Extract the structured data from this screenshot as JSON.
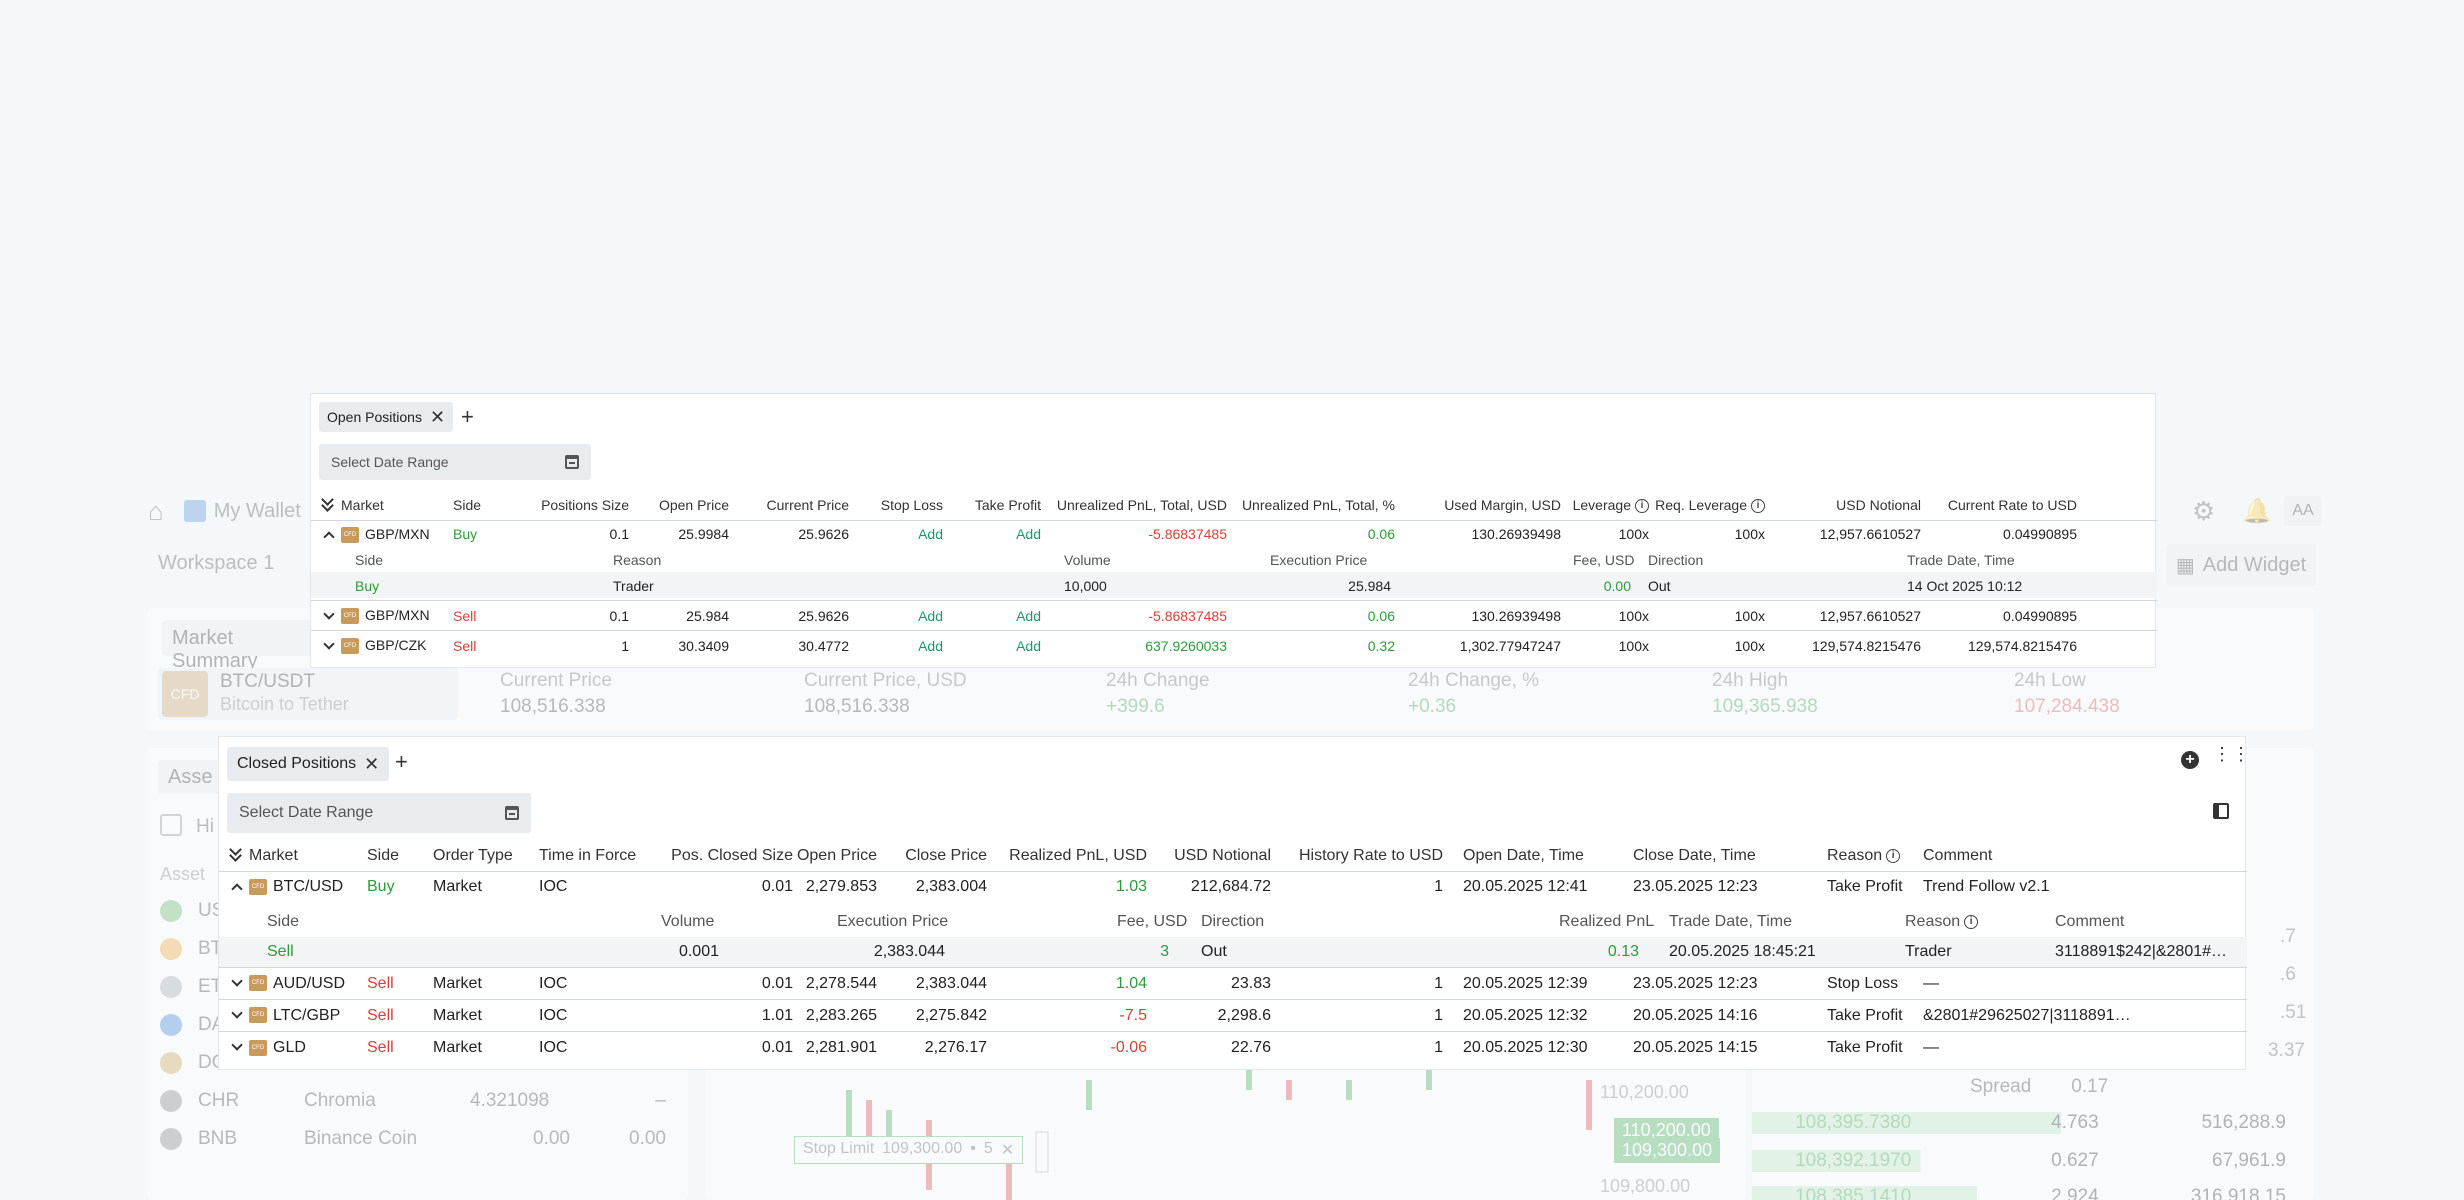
{
  "background": {
    "nav": {
      "wallet": "My Wallet",
      "avatar": "AA"
    },
    "workspace_title": "Workspace 1",
    "add_widget": "Add Widget",
    "market_summary": {
      "tab": "Market Summary",
      "symbol": "BTC/USDT",
      "symbol_sub": "Bitcoin to Tether",
      "cfd": "CFD",
      "stats": [
        {
          "label": "Current Price",
          "value": "108,516.338"
        },
        {
          "label": "Current Price, USD",
          "value": "108,516.338"
        },
        {
          "label": "24h Change",
          "value": "+399.6"
        },
        {
          "label": "24h Change, %",
          "value": "+0.36"
        },
        {
          "label": "24h High",
          "value": "109,365.938"
        },
        {
          "label": "24h Low",
          "value": "107,284.438"
        }
      ]
    },
    "assets": {
      "tab": "Asse",
      "hide_label": "Hi",
      "col_asset": "Asset",
      "rows": [
        {
          "code": "USD",
          "name": "",
          "a": "",
          "b": ""
        },
        {
          "code": "BTC",
          "name": "",
          "a": "",
          "b": ""
        },
        {
          "code": "ETH",
          "name": "",
          "a": "",
          "b": ""
        },
        {
          "code": "DAS",
          "name": "",
          "a": "",
          "b": ""
        },
        {
          "code": "DOG",
          "name": "",
          "a": "",
          "b": ""
        },
        {
          "code": "CHR",
          "name": "Chromia",
          "a": "4.321098",
          "b": "–"
        },
        {
          "code": "BNB",
          "name": "Binance Coin",
          "a": "0.00",
          "b": "0.00"
        }
      ]
    },
    "chart": {
      "prices": [
        "110,200.00",
        "110,200.00",
        "109,300.00",
        "109,800.00"
      ],
      "stop_limit": "Stop Limit",
      "stop_limit_price": "109,300.00",
      "stop_limit_qty": "5"
    },
    "book": {
      "spread_label": "Spread",
      "spread_value": "0.17",
      "side_values": [
        ".7",
        ".6",
        ".51",
        "3.37"
      ],
      "rows": [
        {
          "price": "108,395.7380",
          "qty": "4.763",
          "total": "516,288.9"
        },
        {
          "price": "108,392.1970",
          "qty": "0.627",
          "total": "67,961.9"
        },
        {
          "price": "108,385.1410",
          "qty": "2.924",
          "total": "316,918.15"
        }
      ]
    }
  },
  "open_positions": {
    "tab_label": "Open Positions",
    "date_range_placeholder": "Select Date Range",
    "columns": [
      "Market",
      "Side",
      "Positions Size",
      "Open Price",
      "Current Price",
      "Stop Loss",
      "Take Profit",
      "Unrealized PnL, Total, USD",
      "Unrealized PnL, Total, %",
      "Used Margin, USD",
      "Leverage",
      "Req. Leverage",
      "USD Notional",
      "Current Rate to USD"
    ],
    "sub_columns": [
      "Side",
      "Reason",
      "Volume",
      "Execution Price",
      "Fee, USD",
      "Direction",
      "Trade Date, Time"
    ],
    "rows": [
      {
        "market": "GBP/MXN",
        "side": "Buy",
        "size": "0.1",
        "open_price": "25.9984",
        "current_price": "25.9626",
        "stop_loss": "Add",
        "take_profit": "Add",
        "pnl_usd": "-5.86837485",
        "pnl_pct": "0.06",
        "margin": "130.26939498",
        "leverage": "100x",
        "req_leverage": "100x",
        "notional": "12,957.6610527",
        "rate": "0.04990895",
        "expanded": true
      },
      {
        "market": "GBP/MXN",
        "side": "Sell",
        "size": "0.1",
        "open_price": "25.984",
        "current_price": "25.9626",
        "stop_loss": "Add",
        "take_profit": "Add",
        "pnl_usd": "-5.86837485",
        "pnl_pct": "0.06",
        "margin": "130.26939498",
        "leverage": "100x",
        "req_leverage": "100x",
        "notional": "12,957.6610527",
        "rate": "0.04990895"
      },
      {
        "market": "GBP/CZK",
        "side": "Sell",
        "size": "1",
        "open_price": "30.3409",
        "current_price": "30.4772",
        "stop_loss": "Add",
        "take_profit": "Add",
        "pnl_usd": "637.9260033",
        "pnl_pct": "0.32",
        "margin": "1,302.77947247",
        "leverage": "100x",
        "req_leverage": "100x",
        "notional": "129,574.8215476",
        "rate": "129,574.8215476"
      }
    ],
    "detail": {
      "side": "Buy",
      "reason": "Trader",
      "volume": "10,000",
      "exec_price": "25.984",
      "fee": "0.00",
      "direction": "Out",
      "trade_time": "14 Oct 2025 10:12"
    }
  },
  "closed_positions": {
    "tab_label": "Closed Positions",
    "date_range_placeholder": "Select Date Range",
    "columns": [
      "Market",
      "Side",
      "Order Type",
      "Time in Force",
      "Pos. Closed Size",
      "Open Price",
      "Close Price",
      "Realized PnL, USD",
      "USD Notional",
      "History Rate to USD",
      "Open Date, Time",
      "Close Date, Time",
      "Reason",
      "Comment"
    ],
    "sub_columns": [
      "Side",
      "Volume",
      "Execution Price",
      "Fee, USD",
      "Direction",
      "Realized PnL",
      "Trade Date, Time",
      "Reason",
      "Comment"
    ],
    "rows": [
      {
        "market": "BTC/USD",
        "side": "Buy",
        "order_type": "Market",
        "tif": "IOC",
        "size": "0.01",
        "open_price": "2,279.853",
        "close_price": "2,383.004",
        "pnl": "1.03",
        "notional": "212,684.72",
        "rate": "1",
        "open_time": "20.05.2025 12:41",
        "close_time": "23.05.2025 12:23",
        "reason": "Take Profit",
        "comment": "Trend Follow v2.1",
        "expanded": true
      },
      {
        "market": "AUD/USD",
        "side": "Sell",
        "order_type": "Market",
        "tif": "IOC",
        "size": "0.01",
        "open_price": "2,278.544",
        "close_price": "2,383.044",
        "pnl": "1.04",
        "notional": "23.83",
        "rate": "1",
        "open_time": "20.05.2025 12:39",
        "close_time": "23.05.2025 12:23",
        "reason": "Stop Loss",
        "comment": "—"
      },
      {
        "market": "LTC/GBP",
        "side": "Sell",
        "order_type": "Market",
        "tif": "IOC",
        "size": "1.01",
        "open_price": "2,283.265",
        "close_price": "2,275.842",
        "pnl": "-7.5",
        "notional": "2,298.6",
        "rate": "1",
        "open_time": "20.05.2025 12:32",
        "close_time": "20.05.2025 14:16",
        "reason": "Take Profit",
        "comment": "&2801#29625027|3118891…"
      },
      {
        "market": "GLD",
        "side": "Sell",
        "order_type": "Market",
        "tif": "IOC",
        "size": "0.01",
        "open_price": "2,281.901",
        "close_price": "2,276.17",
        "pnl": "-0.06",
        "notional": "22.76",
        "rate": "1",
        "open_time": "20.05.2025 12:30",
        "close_time": "20.05.2025 14:15",
        "reason": "Take Profit",
        "comment": "—"
      }
    ],
    "detail": {
      "side": "Sell",
      "volume": "0.001",
      "exec_price": "2,383.044",
      "fee": "3",
      "direction": "Out",
      "pnl": "0.13",
      "trade_time": "20.05.2025 18:45:21",
      "reason": "Trader",
      "comment": "3118891$242|&2801#…"
    }
  },
  "colors": {
    "buy": "#2a9d3a",
    "sell": "#d9403a",
    "add": "#179a74",
    "cfd": "#c89a5c"
  }
}
